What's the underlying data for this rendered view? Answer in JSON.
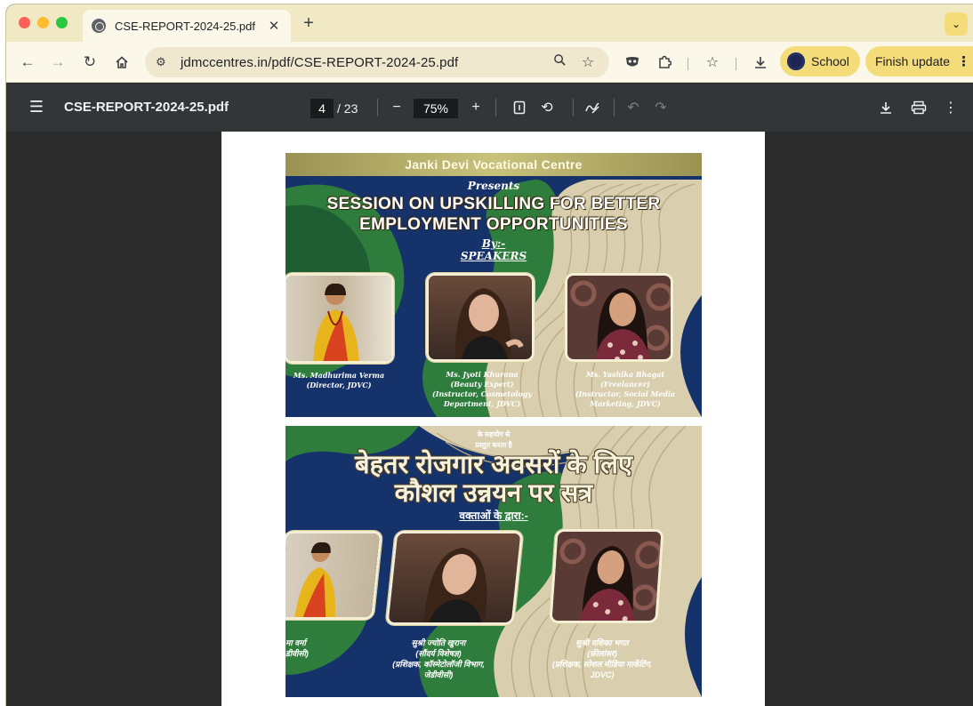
{
  "browser": {
    "tab_title": "CSE-REPORT-2024-25.pdf",
    "new_tab_label": "+",
    "url": "jdmccentres.in/pdf/CSE-REPORT-2024-25.pdf",
    "profile_label": "School",
    "update_label": "Finish update"
  },
  "pdf_viewer": {
    "title": "CSE-REPORT-2024-25.pdf",
    "current_page": "4",
    "page_total": "/ 23",
    "zoom": "75%",
    "zoom_out_label": "−",
    "zoom_in_label": "+"
  },
  "poster_en": {
    "organization": "Janki Devi Vocational Centre",
    "presents": "Presents",
    "headline_line1": "SESSION ON UPSKILLING FOR BETTER",
    "headline_line2": "EMPLOYMENT OPPORTUNITIES",
    "by": "By:-",
    "speakers": "SPEAKERS",
    "speaker1": {
      "name": "Ms. Madhurima Verma",
      "role": "(Director, JDVC)"
    },
    "speaker2": {
      "name": "Ms. Jyoti Khurana",
      "role1": "(Beauty Expert)",
      "role2": "(Instructor, Cosmetology",
      "role3": "Department, JDVC)"
    },
    "speaker3": {
      "name": "Ms. Yashika Bhagat",
      "role1": "(Freelancer)",
      "role2": "(Instructor, Social Media",
      "role3": "Marketing, JDVC)"
    }
  },
  "poster_hi": {
    "collab": "के सहयोग से",
    "presents": "प्रस्तुत करता है",
    "headline_line1": "बेहतर रोजगार अवसरों के लिए",
    "headline_line2": "कौशल उन्नयन पर सत्र",
    "by": "वक्ताओं के द्वारा:-",
    "speaker1": {
      "name": "मा वर्मा",
      "role": "डीवीसी)"
    },
    "speaker2": {
      "name": "सुश्री ज्योति खुराना",
      "role1": "(सौंदर्य विशेषज्ञ)",
      "role2": "(प्रशिक्षक, कॉस्मेटोलॉजी विभाग,",
      "role3": "जेडीवीसी)"
    },
    "speaker3": {
      "name": "सुश्री यशिका भगत",
      "role1": "(फ्रीलांसर)",
      "role2": "(प्रशिक्षक, सोशल मीडिया मार्केटिंग,",
      "role3": "JDVC)"
    }
  },
  "colors": {
    "tabstrip": "#f1e9c4",
    "toolbar": "#fbf8ea",
    "accent_pill": "#f5dc7a",
    "pdf_toolbar": "#323639",
    "viewer_bg": "#2b2b2b",
    "poster_navy": "#16326b",
    "poster_green": "#2e7d3c",
    "poster_sand": "#d9cfae"
  },
  "icons": {
    "tab_favicon": "globe-icon",
    "back": "arrow-left-icon",
    "forward": "arrow-right-icon",
    "reload": "reload-icon",
    "home": "home-icon",
    "site_info": "tune-icon",
    "zoom": "magnifier-icon",
    "bookmark": "star-icon",
    "extensions": "puzzle-icon",
    "download": "download-icon",
    "print": "print-icon",
    "rotate": "rotate-icon",
    "annotate": "pen-icon",
    "fit_page": "fit-page-icon",
    "more": "more-vertical-icon"
  }
}
